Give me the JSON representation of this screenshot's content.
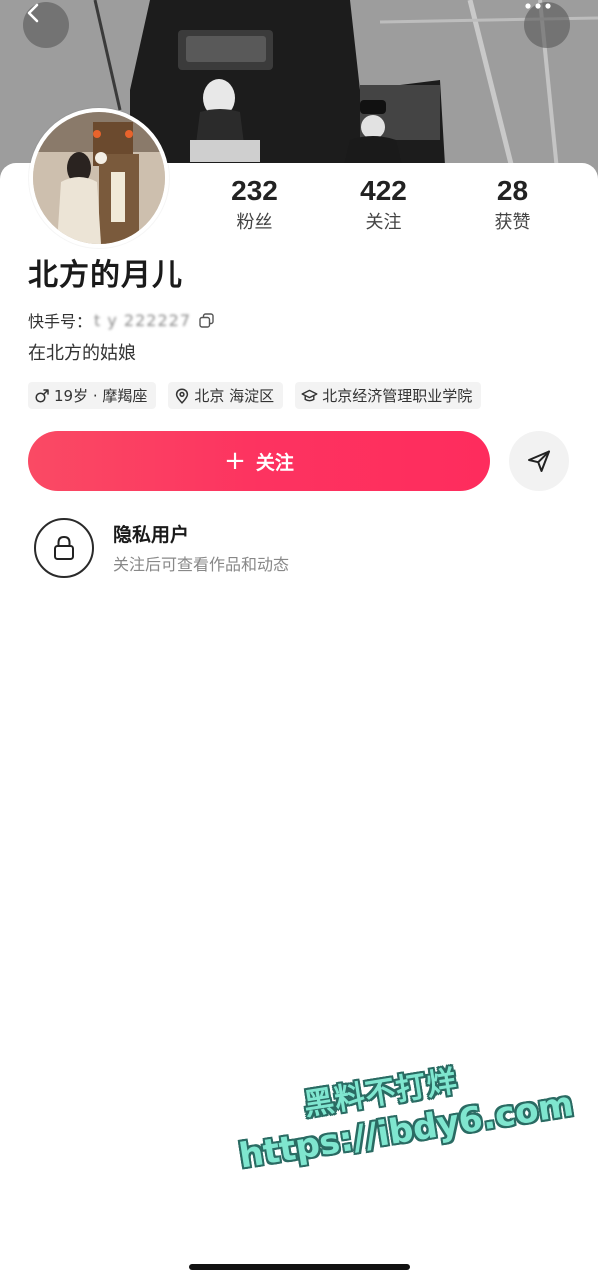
{
  "nav": {
    "back_icon": "chevron-left-icon",
    "more_icon": "more-dots-icon"
  },
  "profile": {
    "name": "北方的月儿",
    "uid_label": "快手号：",
    "uid_value": "t y 222227",
    "bio": "在北方的姑娘"
  },
  "stats": [
    {
      "value": "232",
      "label": "粉丝"
    },
    {
      "value": "422",
      "label": "关注"
    },
    {
      "value": "28",
      "label": "获赞"
    }
  ],
  "tags": [
    {
      "icon": "male-icon",
      "text": "19岁 · 摩羯座"
    },
    {
      "icon": "location-pin-icon",
      "text": "北京 海淀区"
    },
    {
      "icon": "graduation-cap-icon",
      "text": "北京经济管理职业学院"
    }
  ],
  "actions": {
    "follow_label": "关注",
    "follow_plus": "+",
    "share_icon": "send-icon"
  },
  "private": {
    "icon": "lock-icon",
    "title": "隐私用户",
    "subtitle": "关注后可查看作品和动态"
  },
  "watermark": {
    "line1": "黑料不打烊",
    "line2": "https://ibdy6.com"
  },
  "colors": {
    "accent": "#fe2c5d",
    "watermark_fill": "#7fe6cf",
    "watermark_stroke": "#2a6b63"
  }
}
